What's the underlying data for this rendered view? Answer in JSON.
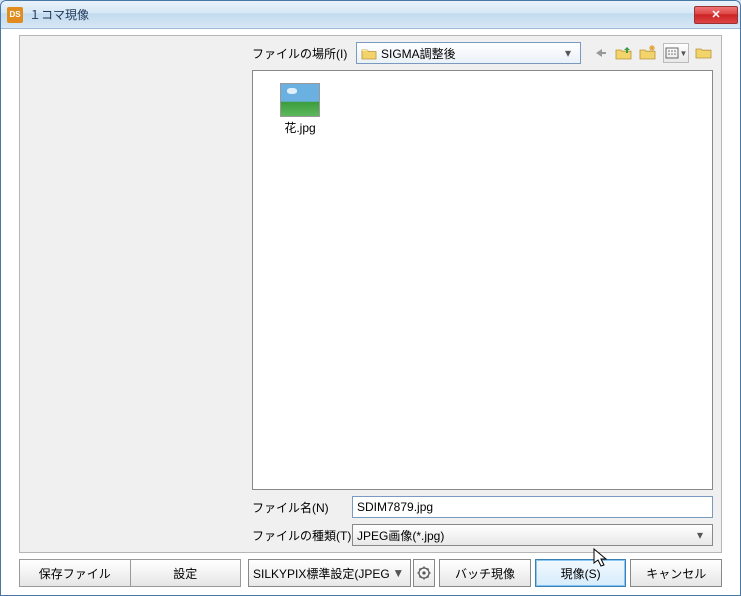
{
  "window": {
    "title": "１コマ現像"
  },
  "location": {
    "label": "ファイルの場所(I)",
    "folder": "SIGMA調整後"
  },
  "files": [
    {
      "name": "花.jpg"
    }
  ],
  "filename": {
    "label": "ファイル名(N)",
    "value": "SDIM7879.jpg"
  },
  "filetype": {
    "label": "ファイルの種類(T)",
    "value": "JPEG画像(*.jpg)"
  },
  "tabs": {
    "save_file": "保存ファイル",
    "settings": "設定"
  },
  "preset": "SILKYPIX標準設定(JPEG",
  "buttons": {
    "batch": "バッチ現像",
    "develop": "現像(S)",
    "cancel": "キャンセル"
  }
}
